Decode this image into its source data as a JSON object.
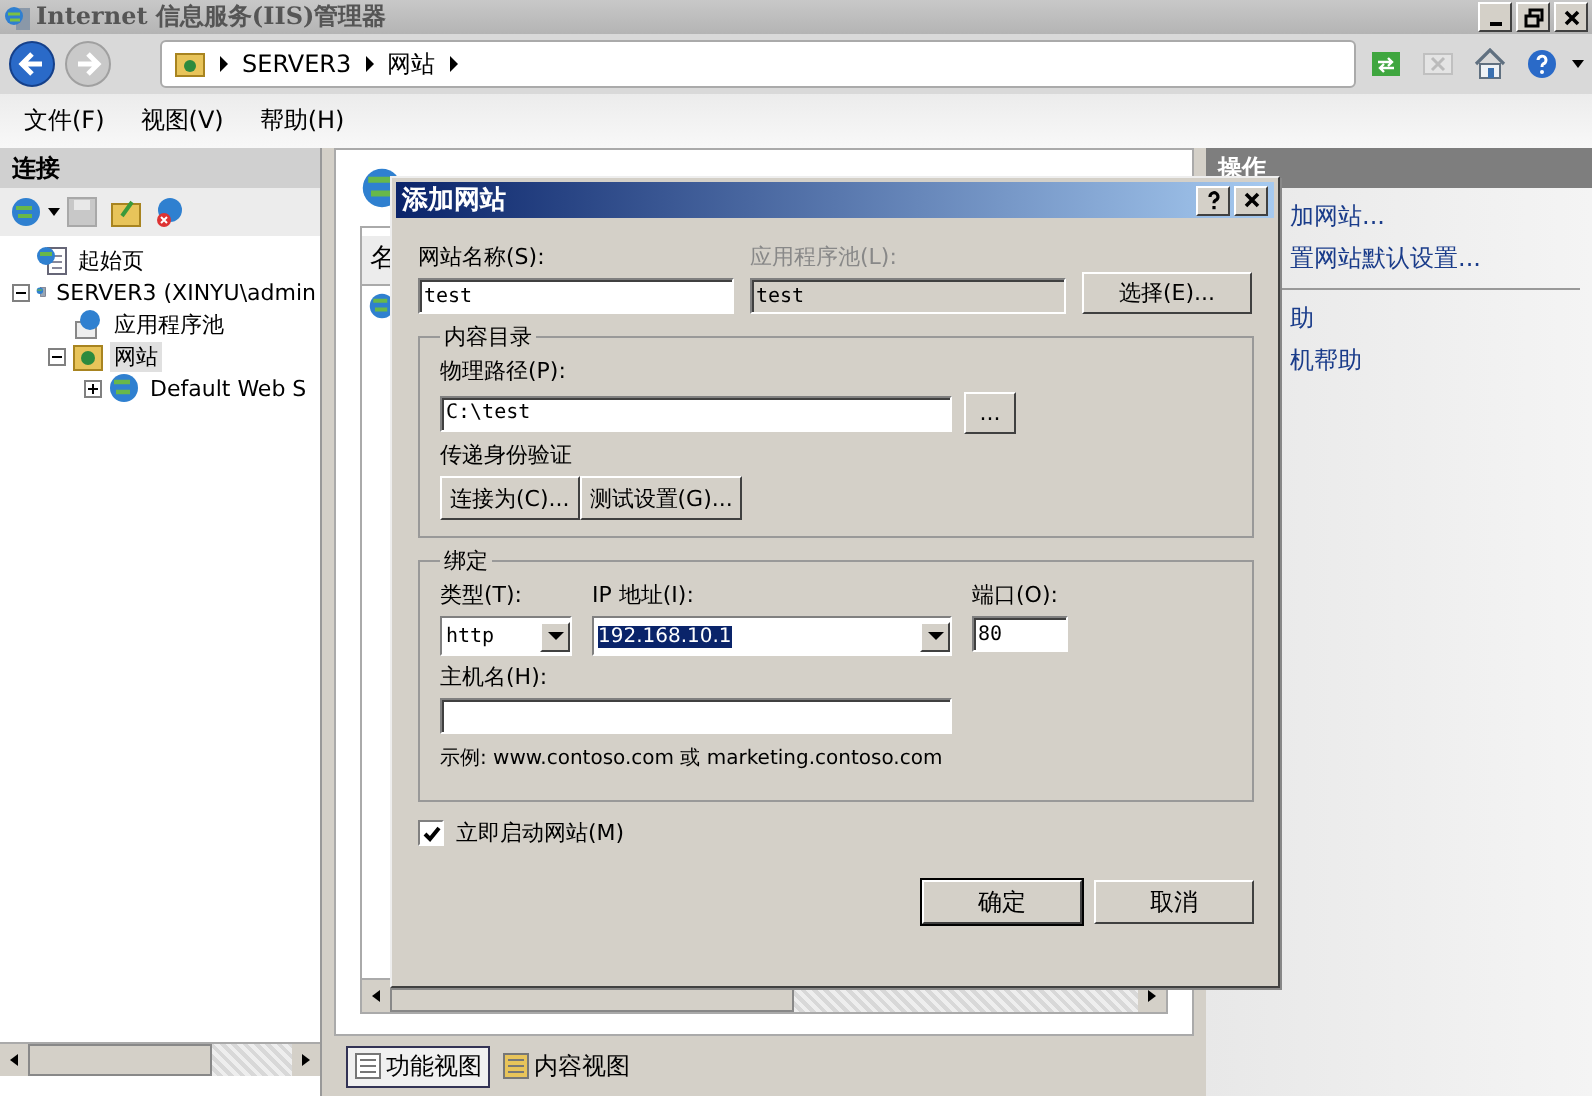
{
  "window": {
    "title": "Internet 信息服务(IIS)管理器"
  },
  "address": {
    "crumbs": [
      "SERVER3",
      "网站"
    ]
  },
  "menu": [
    "文件(F)",
    "视图(V)",
    "帮助(H)"
  ],
  "connections": {
    "title": "连接",
    "tree": [
      {
        "label": "起始页",
        "kind": "page"
      },
      {
        "label": "SERVER3 (XINYU\\admin",
        "kind": "server",
        "expanded": true,
        "children": [
          {
            "label": "应用程序池",
            "kind": "pool"
          },
          {
            "label": "网站",
            "kind": "folder",
            "expanded": true,
            "selected": true,
            "children": [
              {
                "label": "Default Web S",
                "kind": "globe",
                "expanded": false
              }
            ]
          }
        ]
      }
    ]
  },
  "center": {
    "column_1": "名",
    "view_tabs": [
      {
        "label": "功能视图",
        "selected": true
      },
      {
        "label": "内容视图",
        "selected": false
      }
    ]
  },
  "actions": {
    "title": "操作",
    "links": [
      "加网站...",
      "置网站默认设置...",
      "助",
      "机帮助"
    ]
  },
  "dialog": {
    "title": "添加网站",
    "site_name_label": "网站名称(S):",
    "site_name": "test",
    "pool_label": "应用程序池(L):",
    "pool": "test",
    "select_button": "选择(E)...",
    "content_group": "内容目录",
    "path_label": "物理路径(P):",
    "path": "C:\\test",
    "browse_button": "...",
    "auth_label": "传递身份验证",
    "connect_button": "连接为(C)...",
    "test_button": "测试设置(G)...",
    "binding_group": "绑定",
    "type_label": "类型(T):",
    "type": "http",
    "ip_label": "IP 地址(I):",
    "ip": "192.168.10.1",
    "port_label": "端口(O):",
    "port": "80",
    "host_label": "主机名(H):",
    "example": "示例: www.contoso.com 或 marketing.contoso.com",
    "start_now": {
      "label": "立即启动网站(M)",
      "checked": true
    },
    "ok_button": "确定",
    "cancel_button": "取消"
  }
}
